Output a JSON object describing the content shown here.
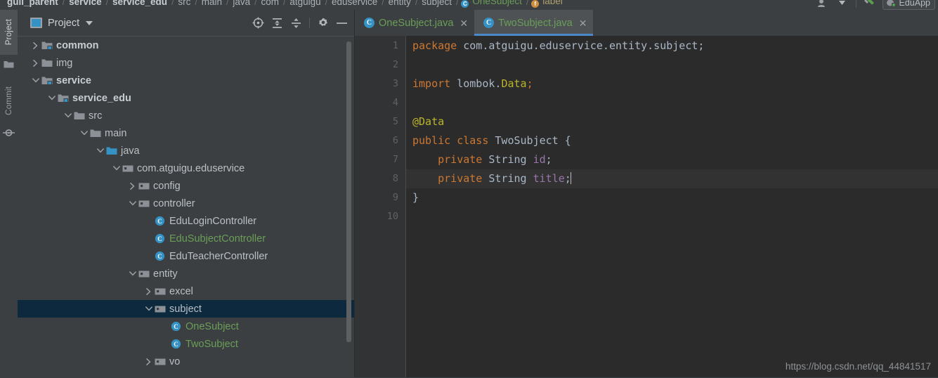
{
  "navbar": {
    "breadcrumb": [
      {
        "label": "guli_parent",
        "style": "bold"
      },
      {
        "label": "service",
        "style": "bold"
      },
      {
        "label": "service_edu",
        "style": "bold"
      },
      {
        "label": "src",
        "style": "plain"
      },
      {
        "label": "main",
        "style": "plain"
      },
      {
        "label": "java",
        "style": "plain"
      },
      {
        "label": "com",
        "style": "plain"
      },
      {
        "label": "atguigu",
        "style": "plain"
      },
      {
        "label": "eduservice",
        "style": "plain"
      },
      {
        "label": "entity",
        "style": "plain"
      },
      {
        "label": "subject",
        "style": "plain"
      },
      {
        "label": "OneSubject",
        "style": "class",
        "icon": "class-icon",
        "icon_letter": "C"
      },
      {
        "label": "label",
        "style": "field",
        "icon": "field-icon",
        "icon_letter": "f"
      }
    ],
    "separator": "/",
    "right_icons": [
      "person-settings-icon",
      "chevron-down-icon",
      "wrench-icon"
    ],
    "run_config": {
      "label": "EduApp",
      "icon": "run-configuration-icon"
    }
  },
  "toolstrip": {
    "tabs": [
      {
        "label": "Project",
        "active": true,
        "icon": "folder-icon"
      },
      {
        "label": "Commit",
        "active": false,
        "icon": "commit-icon"
      }
    ]
  },
  "project_panel": {
    "title": "Project",
    "title_icon": "project-view-icon",
    "dropdown_icon": "chevron-down-icon",
    "tools": [
      {
        "name": "scroll-from-source-icon",
        "tooltip": "Select Opened File"
      },
      {
        "name": "expand-all-icon",
        "tooltip": "Expand All"
      },
      {
        "name": "collapse-all-icon",
        "tooltip": "Collapse All"
      },
      {
        "name": "gear-icon",
        "tooltip": "Settings"
      },
      {
        "name": "minimize-icon",
        "tooltip": "Hide"
      }
    ],
    "tree": [
      {
        "label": "common",
        "indent": 1,
        "twisty": "collapsed",
        "icon": "module-folder-icon",
        "style": "bold",
        "selected": false
      },
      {
        "label": "img",
        "indent": 1,
        "twisty": "collapsed",
        "icon": "folder-icon",
        "style": "plain",
        "selected": false
      },
      {
        "label": "service",
        "indent": 1,
        "twisty": "expanded",
        "icon": "module-folder-icon",
        "style": "bold",
        "selected": false
      },
      {
        "label": "service_edu",
        "indent": 2,
        "twisty": "expanded",
        "icon": "module-folder-icon",
        "style": "bold",
        "selected": false
      },
      {
        "label": "src",
        "indent": 3,
        "twisty": "expanded",
        "icon": "folder-icon",
        "style": "plain",
        "selected": false
      },
      {
        "label": "main",
        "indent": 4,
        "twisty": "expanded",
        "icon": "folder-icon",
        "style": "plain",
        "selected": false
      },
      {
        "label": "java",
        "indent": 5,
        "twisty": "expanded",
        "icon": "source-folder-icon",
        "style": "plain",
        "selected": false
      },
      {
        "label": "com.atguigu.eduservice",
        "indent": 6,
        "twisty": "expanded",
        "icon": "package-icon",
        "style": "plain",
        "selected": false
      },
      {
        "label": "config",
        "indent": 7,
        "twisty": "collapsed",
        "icon": "package-icon",
        "style": "plain",
        "selected": false
      },
      {
        "label": "controller",
        "indent": 7,
        "twisty": "expanded",
        "icon": "package-icon",
        "style": "plain",
        "selected": false
      },
      {
        "label": "EduLoginController",
        "indent": 8,
        "twisty": "none",
        "icon": "class-icon",
        "style": "plain",
        "selected": false
      },
      {
        "label": "EduSubjectController",
        "indent": 8,
        "twisty": "none",
        "icon": "class-icon",
        "style": "green",
        "selected": false
      },
      {
        "label": "EduTeacherController",
        "indent": 8,
        "twisty": "none",
        "icon": "class-icon",
        "style": "plain",
        "selected": false
      },
      {
        "label": "entity",
        "indent": 7,
        "twisty": "expanded",
        "icon": "package-icon",
        "style": "plain",
        "selected": false
      },
      {
        "label": "excel",
        "indent": 8,
        "twisty": "collapsed",
        "icon": "package-icon",
        "style": "plain",
        "selected": false
      },
      {
        "label": "subject",
        "indent": 8,
        "twisty": "expanded",
        "icon": "package-icon",
        "style": "plain",
        "selected": true
      },
      {
        "label": "OneSubject",
        "indent": 9,
        "twisty": "none",
        "icon": "class-icon",
        "style": "green",
        "selected": false
      },
      {
        "label": "TwoSubject",
        "indent": 9,
        "twisty": "none",
        "icon": "class-icon",
        "style": "green",
        "selected": false
      },
      {
        "label": "vo",
        "indent": 8,
        "twisty": "collapsed",
        "icon": "package-icon",
        "style": "plain",
        "selected": false
      }
    ]
  },
  "editor": {
    "tabs": [
      {
        "label": "OneSubject.java",
        "icon": "class-icon",
        "icon_letter": "C",
        "active": false,
        "close_icon": "close-icon"
      },
      {
        "label": "TwoSubject.java",
        "icon": "class-icon",
        "icon_letter": "C",
        "active": true,
        "close_icon": "close-icon"
      }
    ],
    "line_numbers": [
      "1",
      "2",
      "3",
      "4",
      "5",
      "6",
      "7",
      "8",
      "9",
      "10"
    ],
    "caret_line": 8,
    "code_lines": [
      {
        "n": 1,
        "tokens": [
          {
            "t": "package ",
            "c": "kw"
          },
          {
            "t": "com.atguigu.eduservice.entity.subject;",
            "c": "pkg"
          }
        ]
      },
      {
        "n": 2,
        "tokens": []
      },
      {
        "n": 3,
        "tokens": [
          {
            "t": "import ",
            "c": "kw"
          },
          {
            "t": "lombok.",
            "c": "pkg"
          },
          {
            "t": "Data",
            "c": "ann"
          },
          {
            "t": ";",
            "c": "kw"
          }
        ]
      },
      {
        "n": 4,
        "tokens": []
      },
      {
        "n": 5,
        "tokens": [
          {
            "t": "@Data",
            "c": "ann"
          }
        ]
      },
      {
        "n": 6,
        "tokens": [
          {
            "t": "public class ",
            "c": "kw"
          },
          {
            "t": "TwoSubject {",
            "c": "cls"
          }
        ]
      },
      {
        "n": 7,
        "tokens": [
          {
            "t": "    private ",
            "c": "kw"
          },
          {
            "t": "String ",
            "c": "cls"
          },
          {
            "t": "id",
            "c": "fld"
          },
          {
            "t": ";",
            "c": "cls"
          }
        ]
      },
      {
        "n": 8,
        "tokens": [
          {
            "t": "    private ",
            "c": "kw"
          },
          {
            "t": "String ",
            "c": "cls"
          },
          {
            "t": "title",
            "c": "fld"
          },
          {
            "t": ";",
            "c": "cls"
          }
        ]
      },
      {
        "n": 9,
        "tokens": [
          {
            "t": "}",
            "c": "cls"
          }
        ]
      },
      {
        "n": 10,
        "tokens": []
      }
    ]
  },
  "watermark": "https://blog.csdn.net/qq_44841517",
  "colors": {
    "background": "#3c3f41",
    "editor_background": "#2b2b2b",
    "selection": "#0d293e",
    "accent": "#4a88c7",
    "vcs_modified": "#6a9e58",
    "keyword": "#cc7832",
    "annotation": "#bbb529",
    "field": "#9876aa",
    "text": "#a9b7c6"
  }
}
